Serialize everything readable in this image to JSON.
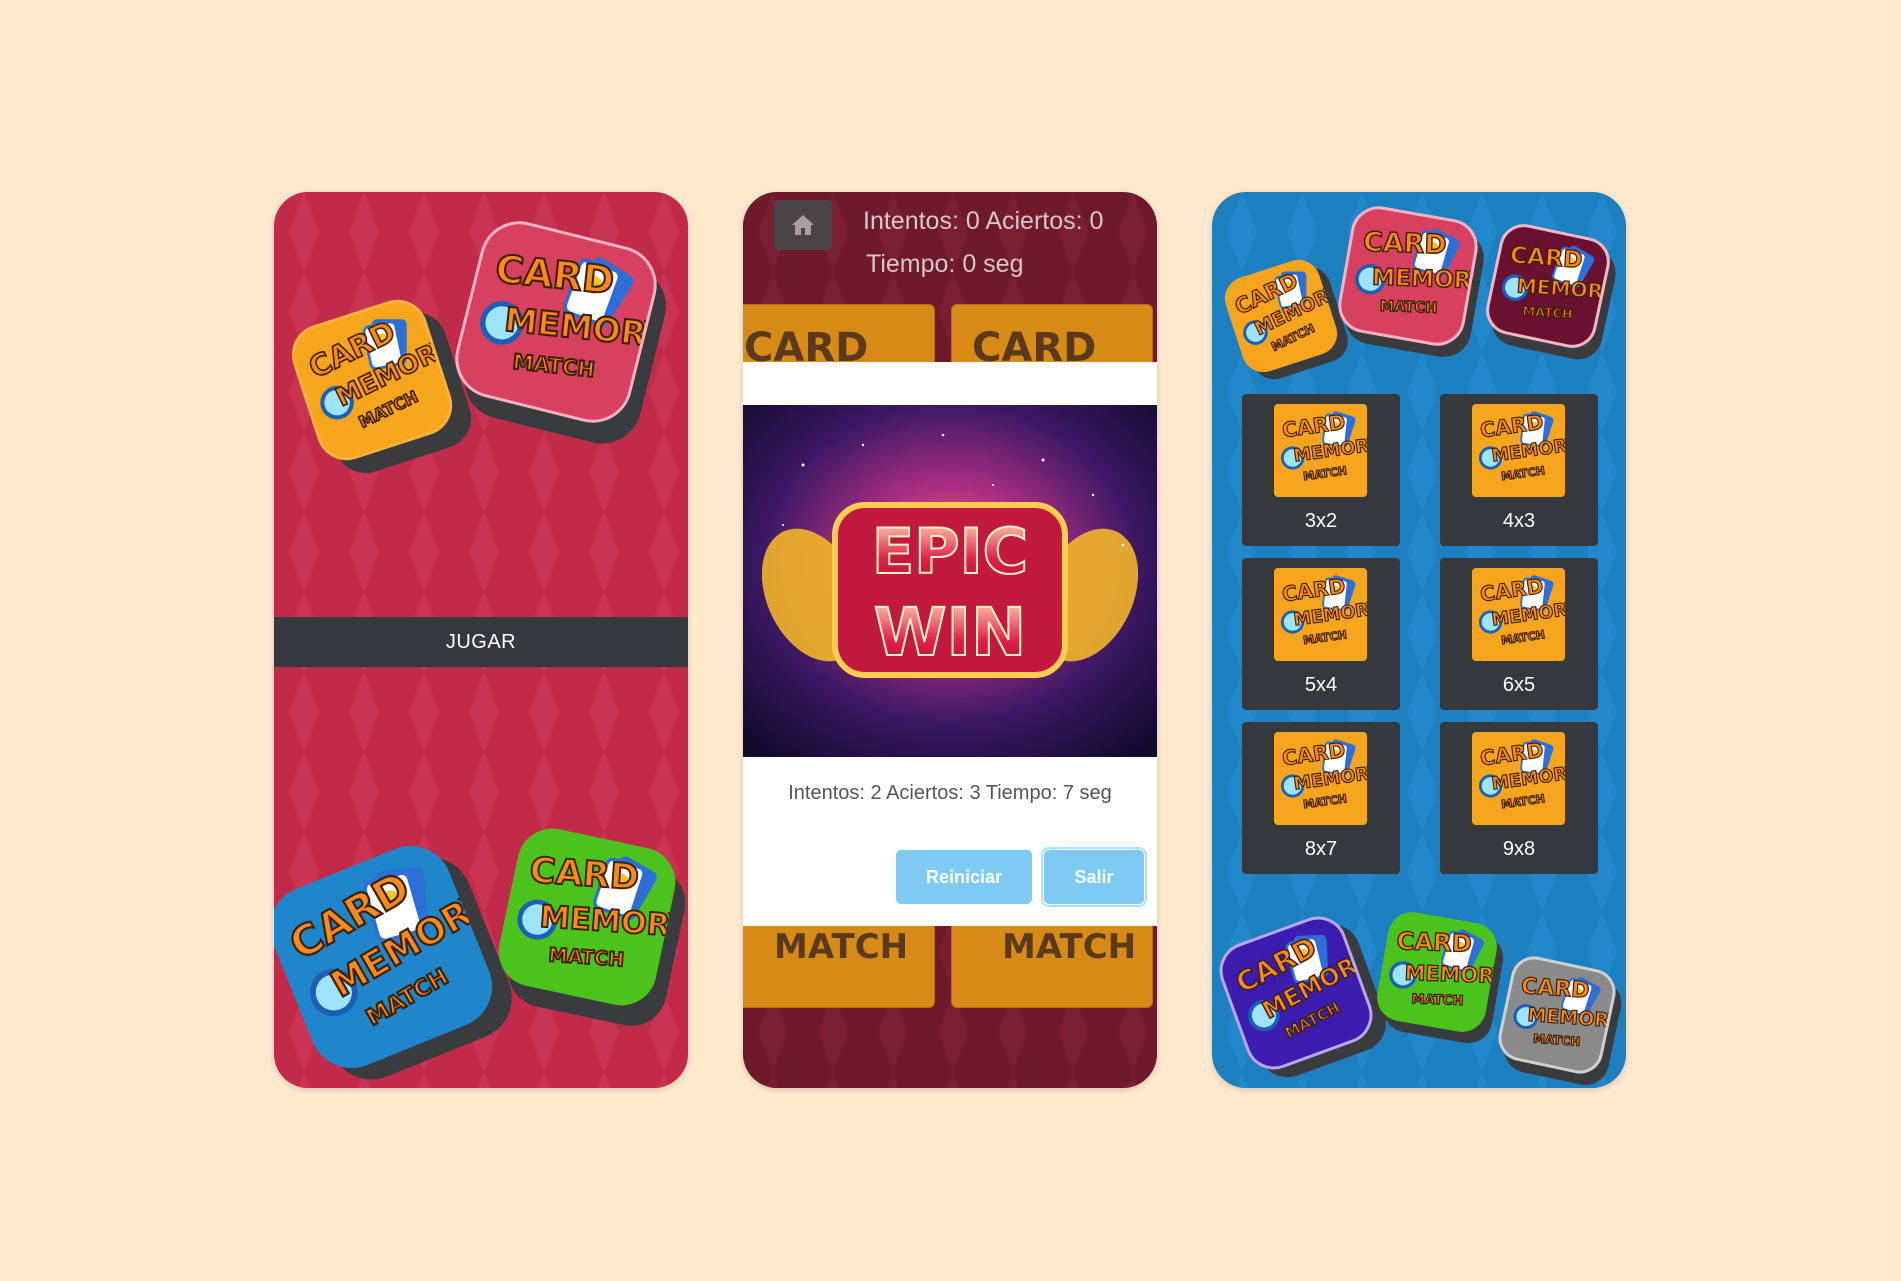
{
  "logo_text": {
    "line1": "CARD",
    "line2": "MEMORY",
    "line3": "MATCH"
  },
  "screen_menu": {
    "play_label": "JUGAR"
  },
  "screen_game": {
    "home_icon": "home-icon",
    "stats_line1": "Intentos: 0 Aciertos: 0",
    "stats_line2": "Tiempo: 0 seg",
    "modal": {
      "image_line1": "EPIC",
      "image_line2": "WIN",
      "result": "Intentos: 2 Aciertos: 3 Tiempo: 7 seg",
      "restart_label": "Reiniciar",
      "exit_label": "Salir"
    }
  },
  "screen_levels": {
    "levels": [
      {
        "label": "3x2"
      },
      {
        "label": "4x3"
      },
      {
        "label": "5x4"
      },
      {
        "label": "6x5"
      },
      {
        "label": "8x7"
      },
      {
        "label": "9x8"
      }
    ]
  },
  "colors": {
    "background": "#fee9cd",
    "menu_bg": "#c12b49",
    "game_bg": "#6e1a2c",
    "levels_bg": "#1c7fc0",
    "button_blue": "#7fcaf3",
    "bar_dark": "#35383d",
    "logo_orange": "#f7a51c",
    "logo_pink": "#d8405f",
    "logo_blue": "#1f86cc",
    "logo_green": "#4cc21d",
    "logo_maroon": "#6a1030",
    "logo_purple": "#3d1cb0",
    "logo_gray": "#8a8a8a"
  }
}
